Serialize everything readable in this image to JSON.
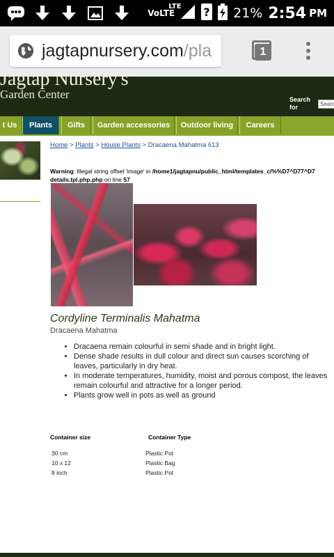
{
  "status_bar": {
    "network": "VoLTE",
    "lte": "LTE",
    "battery_percent": "21%",
    "time": "2:54",
    "ampm": "PM",
    "icons": [
      "bbm-icon",
      "download-icon",
      "download-icon",
      "image-icon",
      "download-icon",
      "signal-icon",
      "sim-unknown-icon",
      "battery-icon"
    ]
  },
  "browser": {
    "url_main": "jagtapnursery.com",
    "url_rest": "/pla",
    "tab_count": "1"
  },
  "site": {
    "title": "Jagtap Nursery's",
    "subtitle": "Garden Center",
    "search_label": "Search for",
    "search_placeholder": "Search"
  },
  "nav": {
    "items": [
      {
        "label": "t Us"
      },
      {
        "label": "Plants"
      },
      {
        "label": "Gifts"
      },
      {
        "label": "Garden accessories"
      },
      {
        "label": "Outdoor living"
      },
      {
        "label": "Careers"
      }
    ]
  },
  "breadcrumb": {
    "home": "Home",
    "sep": ">",
    "plants": "Plants",
    "house_plants": "House Plants",
    "current": "Dracaena Mahatma 613"
  },
  "warning": {
    "label": "Warning",
    "text": ": Illegal string offset 'image' in ",
    "path": "/home1/jagtapnu/public_html/templates_c/%%D7^D77^D7",
    "file": "details.tpl.php.php",
    "line_text": " on line ",
    "line_no": "57"
  },
  "product": {
    "title": "Cordyline Terminalis Mahatma",
    "subtitle": "Dracaena Mahatma",
    "bullets": [
      "Dracaena remain colourful in semi shade and in bright light.",
      "Dense shade results in dull colour and direct sun causes scorching of leaves, particularly in dry heat.",
      "In moderate temperatures, humidity, moist and porous compost, the leaves remain colourful and attractive for a longer period.",
      "Plants grow well in pots as well as ground"
    ]
  },
  "table": {
    "header_size": "Container size",
    "header_type": "Container Type",
    "rows": [
      {
        "size": "30 cm",
        "type": "Plastic Pot"
      },
      {
        "size": "10 x 12",
        "type": "Plastic Bag"
      },
      {
        "size": "8 inch",
        "type": "Plastic Pot"
      }
    ]
  },
  "colors": {
    "header_bg": "#1d2a12",
    "nav_green": "#8aa72c",
    "nav_active": "#0e5066",
    "link_blue": "#1b4fa0"
  }
}
